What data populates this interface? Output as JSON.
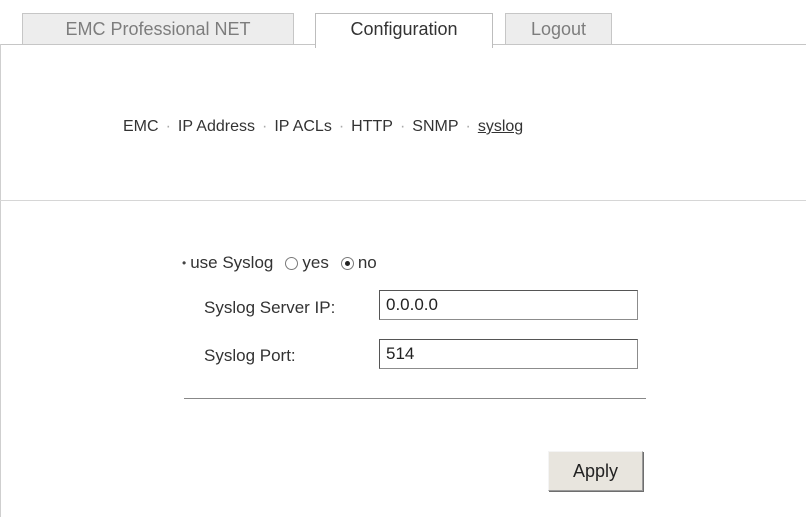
{
  "tabs": [
    {
      "label": "EMC Professional NET",
      "active": false
    },
    {
      "label": "Configuration",
      "active": true
    },
    {
      "label": "Logout",
      "active": false
    }
  ],
  "subnav": {
    "items": [
      "EMC",
      "IP Address",
      "IP ACLs",
      "HTTP",
      "SNMP",
      "syslog"
    ],
    "current": "syslog"
  },
  "form": {
    "use_syslog_label": "use Syslog",
    "option_yes": "yes",
    "option_no": "no",
    "selected": "no",
    "server_ip_label": "Syslog Server IP:",
    "server_ip_value": "0.0.0.0",
    "port_label": "Syslog Port:",
    "port_value": "514",
    "apply_label": "Apply"
  }
}
